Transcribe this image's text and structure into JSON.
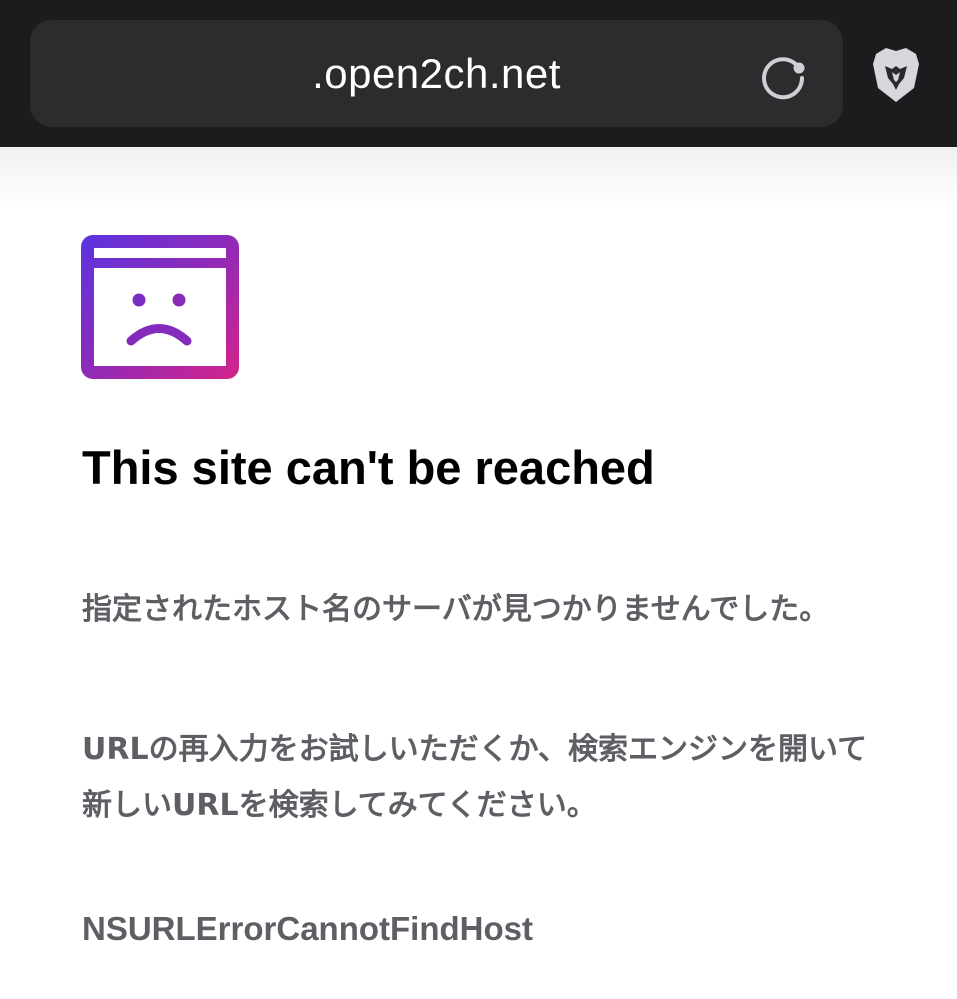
{
  "address_bar": {
    "url": ".open2ch.net",
    "reload_icon": "reload-icon",
    "shield_icon": "brave-lion-shield-icon"
  },
  "error_page": {
    "icon": "sad-browser-window-icon",
    "title": "This site can't be reached",
    "message": "指定されたホスト名のサーバが見つかりませんでした。",
    "suggestion": "URLの再入力をお試しいただくか、検索エンジンを開いて新しいURLを検索してみてください。",
    "error_code": "NSURLErrorCannotFindHost"
  },
  "colors": {
    "toolbar_background": "#1c1c1e",
    "url_field_background": "#2c2c2e",
    "icon_gradient_start": "#6a2ed8",
    "icon_gradient_end": "#c2228a",
    "body_text": "#5e5e64"
  }
}
